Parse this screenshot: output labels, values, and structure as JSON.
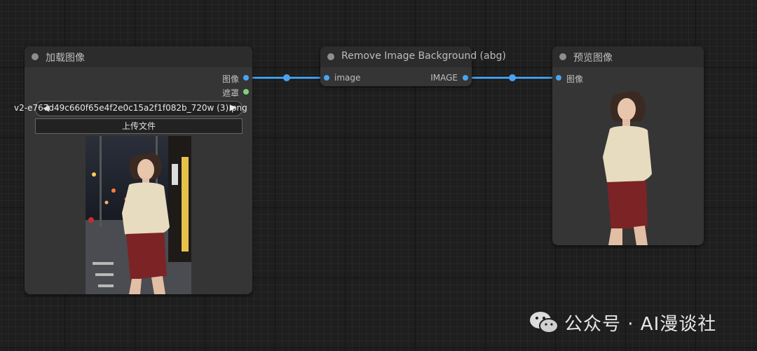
{
  "nodes": {
    "load_image": {
      "title": "加载图像",
      "output_image": "图像",
      "output_mask": "遮罩",
      "file_left_arrow": "◀",
      "filename": "v2-e767d49c660f65e4f2e0c15a2f1f082b_720w (3).png",
      "file_right_arrow": "▶",
      "upload_label": "上传文件"
    },
    "remove_bg": {
      "title": "Remove Image Background (abg)",
      "input_image": "image",
      "output_image": "IMAGE"
    },
    "preview": {
      "title": "预览图像",
      "input_image": "图像"
    }
  },
  "watermark": {
    "text": "公众号 · AI漫谈社",
    "icon": "wechat-icon"
  },
  "colors": {
    "link": "#4aa3f0",
    "mask_slot": "#7ed27e",
    "canvas": "#1e1e1e",
    "node_body": "#353535",
    "node_header": "#2c2c2c"
  }
}
